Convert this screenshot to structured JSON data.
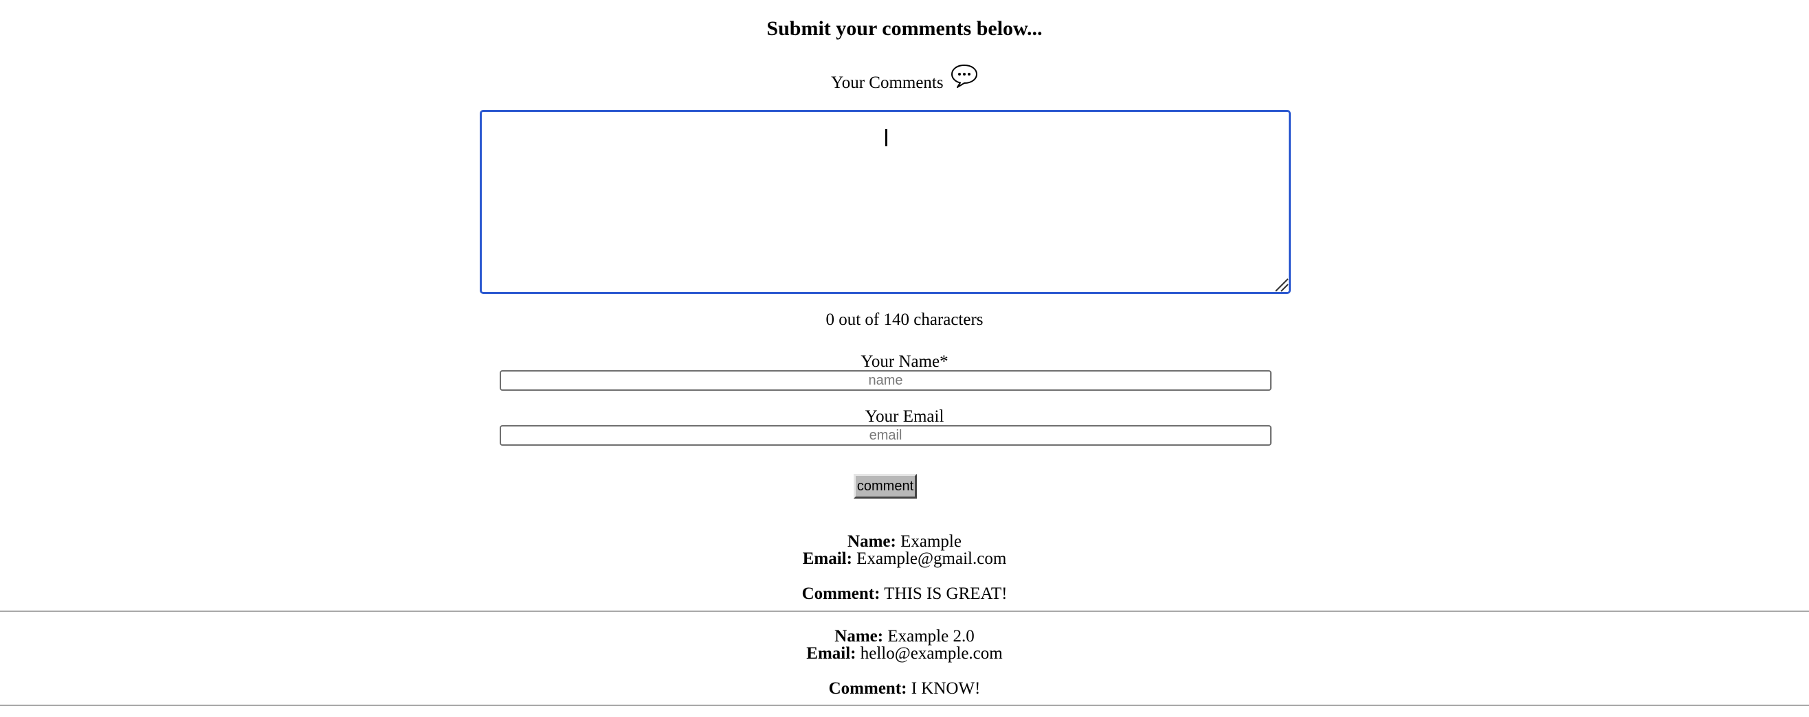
{
  "form": {
    "title": "Submit your comments below...",
    "comments_label": "Your Comments",
    "comments_icon": "speech-bubble-icon",
    "comment_value": "",
    "char_counter": "0 out of 140 characters",
    "name_label": "Your Name*",
    "name_placeholder": "name",
    "email_label": "Your Email",
    "email_placeholder": "email",
    "submit_label": "comment",
    "focus_color": "#2c59d0"
  },
  "comments": [
    {
      "name_label": "Name:",
      "name": "Example",
      "email_label": "Email:",
      "email": "Example@gmail.com",
      "comment_label": "Comment:",
      "comment": "THIS IS GREAT!"
    },
    {
      "name_label": "Name:",
      "name": "Example 2.0",
      "email_label": "Email:",
      "email": "hello@example.com",
      "comment_label": "Comment:",
      "comment": "I KNOW!"
    }
  ]
}
